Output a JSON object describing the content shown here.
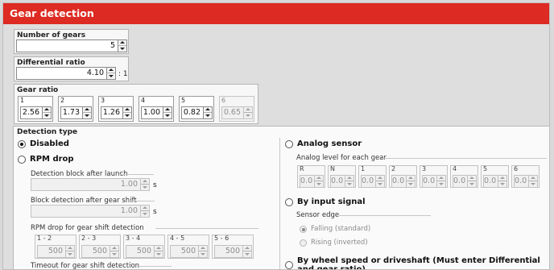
{
  "window": {
    "title": "Gear detection"
  },
  "number_of_gears": {
    "label": "Number of gears",
    "value": "5"
  },
  "differential_ratio": {
    "label": "Differential ratio",
    "value": "4.10",
    "suffix": ": 1"
  },
  "gear_ratio": {
    "label": "Gear ratio",
    "gears": [
      {
        "label": "1",
        "value": "2.56",
        "enabled": true
      },
      {
        "label": "2",
        "value": "1.73",
        "enabled": true
      },
      {
        "label": "3",
        "value": "1.26",
        "enabled": true
      },
      {
        "label": "4",
        "value": "1.00",
        "enabled": true
      },
      {
        "label": "5",
        "value": "0.82",
        "enabled": true
      },
      {
        "label": "6",
        "value": "0.65",
        "enabled": false
      }
    ]
  },
  "detection": {
    "label": "Detection type",
    "disabled_option": {
      "label": "Disabled",
      "selected": true
    },
    "rpm_drop": {
      "label": "RPM drop",
      "block_after_launch": {
        "label": "Detection block after launch",
        "value": "1.00",
        "unit": "s"
      },
      "block_after_shift": {
        "label": "Block detection after gear shift",
        "value": "1.00",
        "unit": "s"
      },
      "rpm_drop_label": "RPM drop for gear shift detection",
      "shifts": [
        {
          "label": "1 - 2",
          "value": "500"
        },
        {
          "label": "2 - 3",
          "value": "500"
        },
        {
          "label": "3 - 4",
          "value": "500"
        },
        {
          "label": "4 - 5",
          "value": "500"
        },
        {
          "label": "5 - 6",
          "value": "500"
        }
      ],
      "timeout_label": "Timeout for gear shift detection"
    },
    "analog_sensor": {
      "label": "Analog sensor",
      "level_label": "Analog level for each gear",
      "levels": [
        {
          "label": "R",
          "value": "0.0"
        },
        {
          "label": "N",
          "value": "0.0"
        },
        {
          "label": "1",
          "value": "0.0"
        },
        {
          "label": "2",
          "value": "0.0"
        },
        {
          "label": "3",
          "value": "0.0"
        },
        {
          "label": "4",
          "value": "0.0"
        },
        {
          "label": "5",
          "value": "0.0"
        },
        {
          "label": "6",
          "value": "0.0"
        }
      ]
    },
    "input_signal": {
      "label": "By input signal",
      "edge_label": "Sensor edge",
      "falling": "Falling (standard)",
      "rising": "Rising (inverted)"
    },
    "wheel_speed": {
      "label": "By wheel speed or driveshaft (Must enter Differential and gear ratio)"
    }
  }
}
